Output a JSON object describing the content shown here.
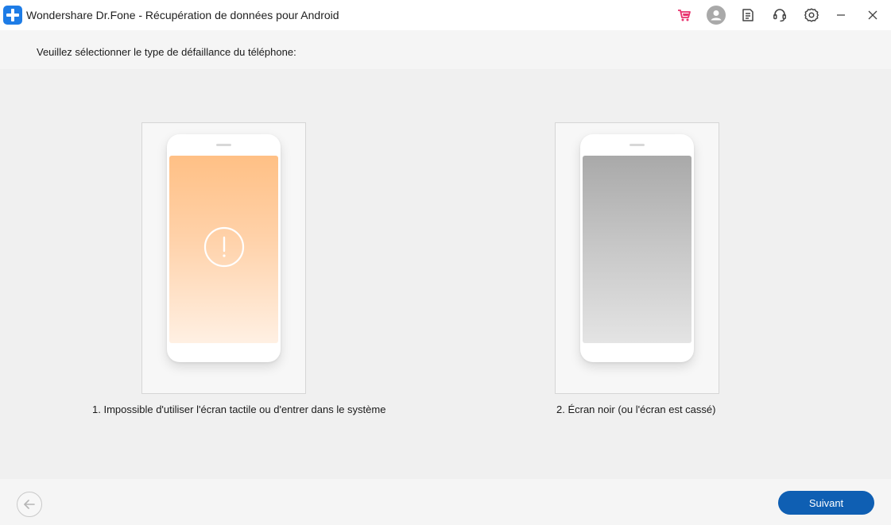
{
  "window": {
    "title": "Wondershare Dr.Fone - Récupération de données pour Android"
  },
  "titlebar_icons": [
    "cart-icon",
    "user-icon",
    "feedback-icon",
    "support-icon",
    "settings-icon",
    "minimize-icon",
    "close-icon"
  ],
  "main": {
    "instruction": "Veuillez sélectionner le type de défaillance du téléphone:",
    "options": [
      {
        "label": "1. Impossible d'utiliser l'écran tactile ou d'entrer dans le système",
        "screen": "orange-warning"
      },
      {
        "label": "2. Écran noir (ou l'écran est cassé)",
        "screen": "gray-blank"
      }
    ]
  },
  "footer": {
    "next_label": "Suivant"
  },
  "colors": {
    "brand_blue": "#1e7ce6",
    "next_button": "#0f5fb3",
    "cart_pink": "#e8336e"
  }
}
